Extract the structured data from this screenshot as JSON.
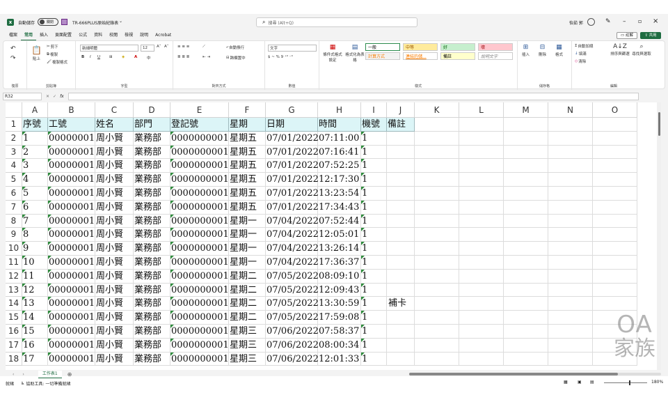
{
  "titlebar": {
    "autosave_label": "自動儲存",
    "autosave_state": "關閉",
    "file_name": "TR-666PLUS原始紀錄表",
    "search_placeholder": "搜尋 (Alt+Q)",
    "user_name": "怡茹 郭"
  },
  "ribbon_tabs": [
    "檔案",
    "常用",
    "插入",
    "頁面配置",
    "公式",
    "資料",
    "校閱",
    "檢視",
    "說明",
    "Acrobat"
  ],
  "ribbon_right": {
    "comments": "註解",
    "share": "共用"
  },
  "ribbon": {
    "undo": {
      "label": "復原"
    },
    "clipboard": {
      "label": "剪貼簿",
      "paste": "貼上",
      "cut": "剪下",
      "copy": "複製",
      "format_painter": "複製格式"
    },
    "font": {
      "label": "字型",
      "font_name": "新細明體",
      "font_size": "12",
      "bold": "B",
      "italic": "I",
      "underline": "U"
    },
    "alignment": {
      "label": "對齊方式",
      "wrap": "自動換行",
      "merge": "跨欄置中"
    },
    "number": {
      "label": "數值",
      "format": "文字"
    },
    "styles": {
      "label": "樣式",
      "cond_format": "條件式格式設定",
      "format_table": "格式化為表格",
      "items": [
        {
          "name": "一般",
          "bg": "#ffffff",
          "fg": "#000000"
        },
        {
          "name": "中等",
          "bg": "#ffeb9c",
          "fg": "#9c5700"
        },
        {
          "name": "好",
          "bg": "#c6efce",
          "fg": "#006100"
        },
        {
          "name": "壞",
          "bg": "#ffc7ce",
          "fg": "#9c0006"
        },
        {
          "name": "計算方式",
          "bg": "#f2f2f2",
          "fg": "#fa7d00"
        },
        {
          "name": "連結的儲...",
          "bg": "#ffffff",
          "fg": "#fa7d00"
        },
        {
          "name": "備註",
          "bg": "#ffffcc",
          "fg": "#000000"
        },
        {
          "name": "說明文字",
          "bg": "#ffffff",
          "fg": "#7f7f7f"
        }
      ]
    },
    "cells": {
      "label": "儲存格",
      "insert": "插入",
      "delete": "刪除",
      "format": "格式"
    },
    "editing": {
      "label": "編輯",
      "autosum": "自動加總",
      "fill": "填滿",
      "clear": "清除",
      "sort_filter": "排序與篩選",
      "find_select": "尋找與選取"
    }
  },
  "formula_bar": {
    "name_box": "R32",
    "fx": "fx",
    "value": ""
  },
  "columns": [
    "A",
    "B",
    "C",
    "D",
    "E",
    "F",
    "G",
    "H",
    "I",
    "J",
    "K",
    "L",
    "M",
    "N",
    "O"
  ],
  "row_numbers": [
    "1",
    "2",
    "3",
    "4",
    "5",
    "6",
    "7",
    "8",
    "9",
    "10",
    "11",
    "12",
    "13",
    "14",
    "15",
    "16",
    "17",
    "18"
  ],
  "header_row": [
    "序號",
    "工號",
    "姓名",
    "部門",
    "登記號",
    "星期",
    "日期",
    "時間",
    "機號",
    "備註"
  ],
  "rows": [
    [
      "1",
      "00000001",
      "周小賢",
      "業務部",
      "0000000001",
      "星期五",
      "07/01/2022",
      "07:11:00",
      "1",
      ""
    ],
    [
      "2",
      "00000001",
      "周小賢",
      "業務部",
      "0000000001",
      "星期五",
      "07/01/2022",
      "07:16:41",
      "1",
      ""
    ],
    [
      "3",
      "00000001",
      "周小賢",
      "業務部",
      "0000000001",
      "星期五",
      "07/01/2022",
      "07:52:25",
      "1",
      ""
    ],
    [
      "4",
      "00000001",
      "周小賢",
      "業務部",
      "0000000001",
      "星期五",
      "07/01/2022",
      "12:17:30",
      "1",
      ""
    ],
    [
      "5",
      "00000001",
      "周小賢",
      "業務部",
      "0000000001",
      "星期五",
      "07/01/2022",
      "13:23:54",
      "1",
      ""
    ],
    [
      "6",
      "00000001",
      "周小賢",
      "業務部",
      "0000000001",
      "星期五",
      "07/01/2022",
      "17:34:43",
      "1",
      ""
    ],
    [
      "7",
      "00000001",
      "周小賢",
      "業務部",
      "0000000001",
      "星期一",
      "07/04/2022",
      "07:52:44",
      "1",
      ""
    ],
    [
      "8",
      "00000001",
      "周小賢",
      "業務部",
      "0000000001",
      "星期一",
      "07/04/2022",
      "12:05:01",
      "1",
      ""
    ],
    [
      "9",
      "00000001",
      "周小賢",
      "業務部",
      "0000000001",
      "星期一",
      "07/04/2022",
      "13:26:14",
      "1",
      ""
    ],
    [
      "10",
      "00000001",
      "周小賢",
      "業務部",
      "0000000001",
      "星期一",
      "07/04/2022",
      "17:36:37",
      "1",
      ""
    ],
    [
      "11",
      "00000001",
      "周小賢",
      "業務部",
      "0000000001",
      "星期二",
      "07/05/2022",
      "08:09:10",
      "1",
      ""
    ],
    [
      "12",
      "00000001",
      "周小賢",
      "業務部",
      "0000000001",
      "星期二",
      "07/05/2022",
      "12:09:43",
      "1",
      ""
    ],
    [
      "13",
      "00000001",
      "周小賢",
      "業務部",
      "0000000001",
      "星期二",
      "07/05/2022",
      "13:30:59",
      "1",
      "補卡"
    ],
    [
      "14",
      "00000001",
      "周小賢",
      "業務部",
      "0000000001",
      "星期二",
      "07/05/2022",
      "17:59:08",
      "1",
      ""
    ],
    [
      "15",
      "00000001",
      "周小賢",
      "業務部",
      "0000000001",
      "星期三",
      "07/06/2022",
      "07:58:37",
      "1",
      ""
    ],
    [
      "16",
      "00000001",
      "周小賢",
      "業務部",
      "0000000001",
      "星期三",
      "07/06/2022",
      "08:00:34",
      "1",
      ""
    ],
    [
      "17",
      "00000001",
      "周小賢",
      "業務部",
      "0000000001",
      "星期三",
      "07/06/2022",
      "12:01:33",
      "1",
      ""
    ]
  ],
  "sheet_tab": "工作表1",
  "status": {
    "ready": "就緒",
    "accessibility": "協助工具: 一切準備就緒",
    "zoom": "180%"
  },
  "watermark": {
    "line1": "OA",
    "line2": "家族"
  },
  "colors": {
    "header_fill": "#dcf5f7",
    "accent": "#1e6c41",
    "error_triangle": "#2e8b3c"
  }
}
